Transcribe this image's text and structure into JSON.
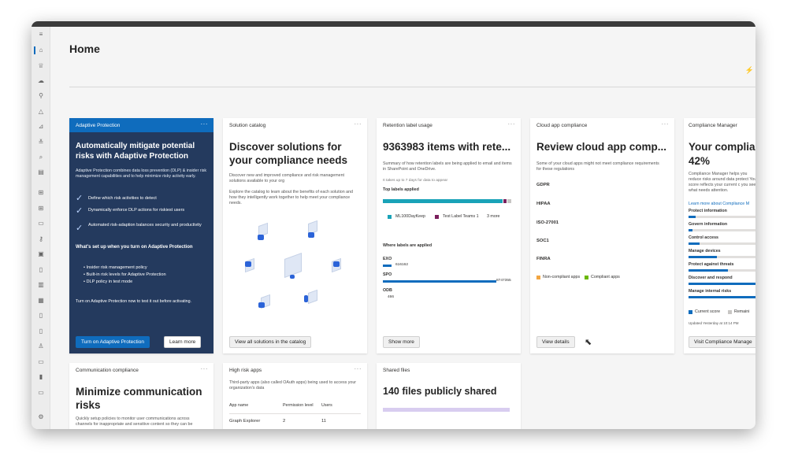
{
  "page": {
    "title": "Home"
  },
  "rail": {
    "icons": [
      "menu-icon",
      "home-icon",
      "trophy-icon",
      "cloud-icon",
      "diagram-icon",
      "alert-icon",
      "chart-icon",
      "filter-icon",
      "search-icon",
      "calendar-icon",
      "grid-icon",
      "grid2-icon",
      "doc-icon",
      "key-icon",
      "image-icon",
      "doc2-icon",
      "building-icon",
      "archive-icon",
      "doc3-icon",
      "doc4-icon",
      "person-icon",
      "doc5-icon",
      "trash-icon",
      "device-icon",
      "settings-icon"
    ]
  },
  "adaptive": {
    "header": "Adaptive Protection",
    "title": "Automatically mitigate potential risks with Adaptive Protection",
    "desc": "Adaptive Protection combines data loss prevention (DLP) & insider risk management capabilities and to help minimize risky activity early.",
    "checks": [
      "Define which risk activities to detect",
      "Dynamically enforce DLP actions for riskiest users",
      "Automated risk-adaption balances security and productivity"
    ],
    "subheading": "What's set up when you turn on Adaptive Protection",
    "bullets": [
      "Insider risk management policy",
      "Built-in risk levels for Adaptive Protection",
      "DLP policy in test mode"
    ],
    "note": "Turn on Adaptive Protection now to test it out before activating.",
    "primary_button": "Turn on Adaptive Protection",
    "secondary_button": "Learn more"
  },
  "catalog": {
    "header": "Solution catalog",
    "title": "Discover solutions for your compliance needs",
    "desc1": "Discover new and improved compliance and risk management solutions available to your org",
    "desc2": "Explore the catalog to learn about the benefits of each solution and how they intelligently work together to help meet your compliance needs.",
    "button": "View all solutions in the catalog"
  },
  "retention": {
    "header": "Retention label usage",
    "title": "9363983 items with rete...",
    "desc": "Summary of how retention labels are being applied to email and items in SharePoint and OneDrive.",
    "note": "It takes up to 7 days for data to appear",
    "top_labels": "Top labels applied",
    "legend": [
      "ML100DayKeep",
      "Test Label Teams 1",
      "3 more"
    ],
    "where": "Where labels are applied",
    "rows": [
      {
        "name": "EXO",
        "value": "616162",
        "frac": 0.07
      },
      {
        "name": "SPO",
        "value": "8747355",
        "frac": 0.93
      },
      {
        "name": "ODB",
        "value": "466",
        "frac": 0.005
      }
    ],
    "button": "Show more",
    "colors": {
      "teal": "#1aa3b8",
      "purple": "#7a1f5c",
      "grey": "#c8c6c4"
    }
  },
  "cloud": {
    "header": "Cloud app compliance",
    "title": "Review cloud app comp...",
    "desc": "Some of your cloud apps might not meet compliance requirements for these regulations",
    "regs": [
      "GDPR",
      "HIPAA",
      "ISO-27001",
      "SOC1",
      "FINRA"
    ],
    "legend": [
      "Non-compliant apps",
      "Compliant apps"
    ],
    "legend_colors": [
      "#f2a541",
      "#6bb700"
    ],
    "button": "View details"
  },
  "manager": {
    "header": "Compliance Manager",
    "title": "Your complia",
    "score": "42%",
    "desc": "Compliance Manager helps you reduce risks around data protect Your score reflects your current c you see what needs attention.",
    "link": "Learn more about Compliance M",
    "items": [
      {
        "name": "Protect information",
        "frac": 0.1
      },
      {
        "name": "Govern information",
        "frac": 0.06
      },
      {
        "name": "Control access",
        "frac": 0.15
      },
      {
        "name": "Manage devices",
        "frac": 0.4
      },
      {
        "name": "Protect against threats",
        "frac": 0.55
      },
      {
        "name": "Discover and respond",
        "frac": 1.0
      },
      {
        "name": "Manage internal risks",
        "frac": 1.0
      }
    ],
    "legend": [
      "Current score",
      "Remaini"
    ],
    "updated": "Updated Yesterday at 10:14 PM",
    "button": "Visit Compliance Manage"
  },
  "communication": {
    "header": "Communication compliance",
    "title": "Minimize communication risks",
    "desc": "Quickly setup policies to monitor user communications across channels for inappropriate and sensitive content so they can be"
  },
  "highrisk": {
    "header": "High risk apps",
    "desc": "Third-party apps (also called OAuth apps) being used to access your organization's data",
    "columns": [
      "App name",
      "Permission level",
      "Users"
    ],
    "rows": [
      [
        "Graph Explorer",
        "2",
        "11"
      ]
    ]
  },
  "shared": {
    "header": "Shared files",
    "title": "140 files publicly shared"
  },
  "more_glyph": "···"
}
